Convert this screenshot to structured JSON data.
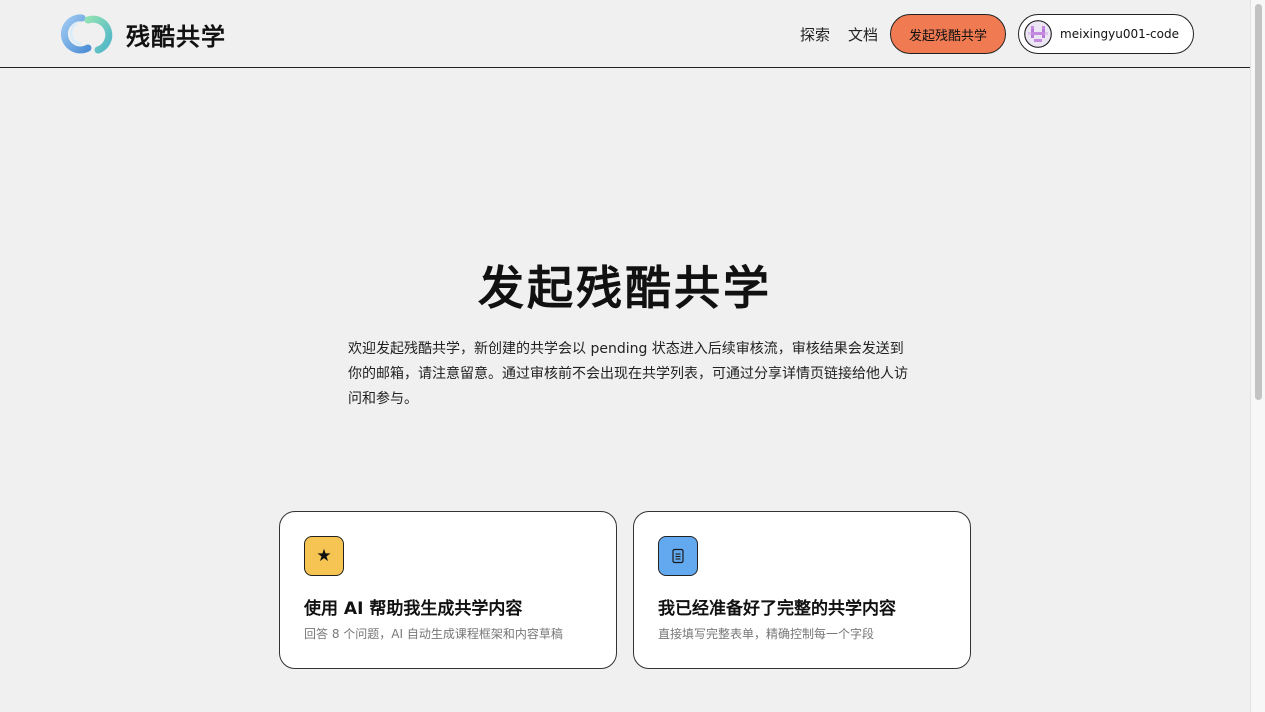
{
  "header": {
    "logo_text": "残酷共学",
    "nav": [
      {
        "label": "探索"
      },
      {
        "label": "文档"
      }
    ],
    "create_button": "发起残酷共学",
    "user": {
      "name": "meixingyu001-code"
    }
  },
  "main": {
    "title": "发起残酷共学",
    "intro_lines": [
      "欢迎发起残酷共学，新创建的共学会以 pending 状态进入后续审核流，审核结果会发送到",
      "你的邮箱，请注意留意。通过审核前不会出现在共学列表，可通过分享详情页链接给他人访",
      "问和参与。"
    ],
    "cards": [
      {
        "icon": "star-icon",
        "icon_color": "#f6c453",
        "title": "使用 AI 帮助我生成共学内容",
        "description": "回答 8 个问题，AI 自动生成课程框架和内容草稿"
      },
      {
        "icon": "document-icon",
        "icon_color": "#63a9ef",
        "title": "我已经准备好了完整的共学内容",
        "description": "直接填写完整表单，精确控制每一个字段"
      }
    ]
  },
  "colors": {
    "accent": "#f07b52",
    "background": "#f0f0f0"
  }
}
